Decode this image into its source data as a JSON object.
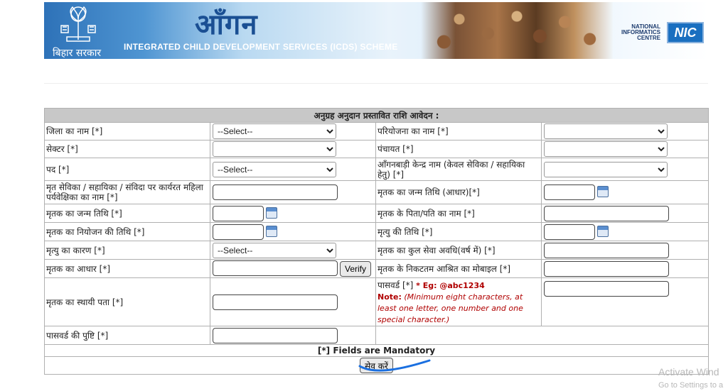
{
  "header": {
    "title_hindi": "आँगन",
    "scheme": "INTEGRATED CHILD DEVELOPMENT SERVICES (ICDS) SCHEME",
    "state": "बिहार सरकार",
    "nic_label": [
      "NATIONAL",
      "INFORMATICS",
      "CENTRE"
    ],
    "nic_logo": "NIC"
  },
  "form": {
    "heading": "अनुग्रह अनुदान प्रस्तावित राशि आवेदन :",
    "fields": {
      "district_label": "जिला का नाम [*]",
      "district_value": "--Select--",
      "project_label": "परियोजना का नाम [*]",
      "project_value": "",
      "sector_label": "सेक्टर [*]",
      "sector_value": "",
      "panchayat_label": "पंचायत [*]",
      "panchayat_value": "",
      "post_label": "पद [*]",
      "post_value": "--Select--",
      "awc_label": "आँगनबाड़ी केन्द्र नाम (केवल सेविका / सहायिका हेतु) [*]",
      "awc_value": "",
      "deceased_name_label": "मृत सेविका / सहायिका / संविदा पर कार्यरत महिला पर्यवेक्षिका का नाम [*]",
      "dob_aadhaar_label": "मृतक का जन्म तिथि (आधार)[*]",
      "dob_label": "मृतक का जन्म तिथि [*]",
      "father_label": "मृतक के पिता/पति का नाम [*]",
      "appointment_label": "मृतक का नियोजन की तिथि [*]",
      "death_date_label": "मृत्यु की तिथि [*]",
      "death_cause_label": "मृत्यु का कारण [*]",
      "death_cause_value": "--Select--",
      "service_label": "मृतक का कुल सेवा अवधि(वर्ष में) [*]",
      "aadhaar_label": "मृतक का आधार [*]",
      "verify_label": "Verify",
      "mobile_label": "मृतक के निकटतम आश्रित का मोबाइल [*]",
      "address_label": "मृतक का स्थायी पता [*]",
      "password_label": "पासवर्ड [*]",
      "password_example": "* Eg: @abc1234",
      "password_note_prefix": "Note:",
      "password_note": "(Minimum eight characters, at least one letter, one number and one special character.)",
      "confirm_label": "पासवर्ड की पुष्टि [*]"
    },
    "mandatory_text": "[*] Fields are Mandatory",
    "save_label": "सेव करें"
  },
  "watermark": {
    "line1": "Activate Wind",
    "line2": "Go to Settings to a"
  },
  "colors": {
    "heading_red": "#8b1a1a",
    "header_bg": "#c8c8c8",
    "annotation_blue": "#1a6fe0"
  }
}
